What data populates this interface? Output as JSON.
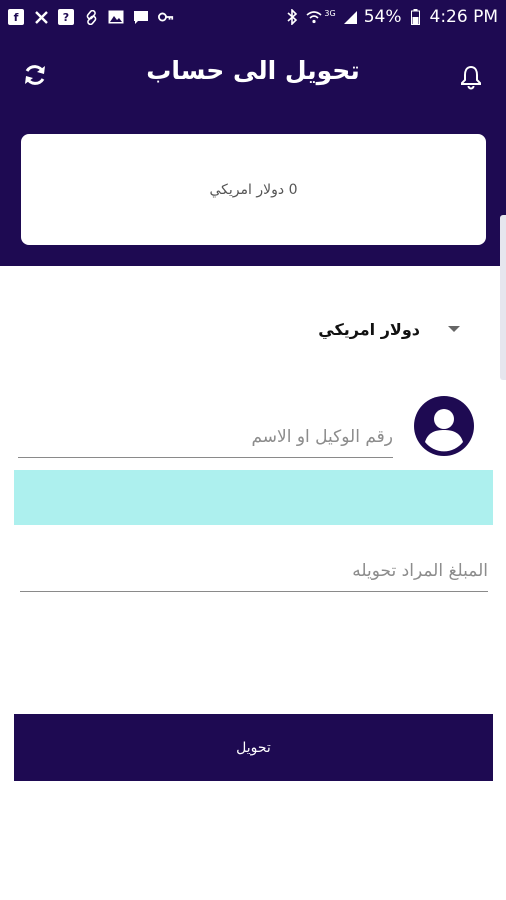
{
  "status_bar": {
    "battery": "54%",
    "time": "4:26 PM",
    "network": "3G",
    "icons": [
      "facebook-icon",
      "crossed-arrows-icon",
      "unknown-app-icon",
      "link-icon",
      "gallery-icon",
      "message-icon",
      "key-icon",
      "bluetooth-icon",
      "wifi-icon",
      "signal-icon",
      "battery-icon"
    ]
  },
  "header": {
    "title": "تحويل الى حساب",
    "left_icon": "refresh-icon",
    "right_icon": "bell-icon",
    "color": "#1e0a52"
  },
  "balance": {
    "text": "0 دولار امريكي"
  },
  "currency_select": {
    "selected": "دولار امريكي"
  },
  "form": {
    "agent_placeholder": "رقم الوكيل او الاسم",
    "amount_placeholder": "المبلغ المراد تحويله",
    "suggestion_color": "#adf0ee"
  },
  "transfer_button": {
    "label": "تحويل"
  }
}
